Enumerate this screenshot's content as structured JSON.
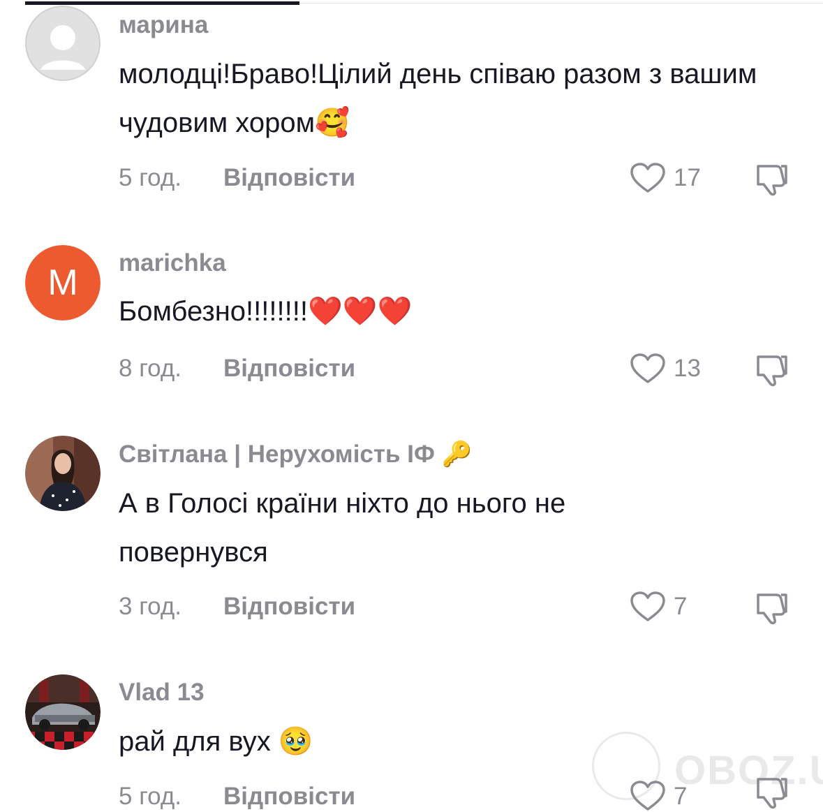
{
  "comments": [
    {
      "username": "марина",
      "text": "молодці!Браво!Цілий день співаю разом з вашим чудовим хором🥰",
      "time": "5 год.",
      "reply_label": "Відповісти",
      "likes": "17",
      "avatar": "default-avatar"
    },
    {
      "username": "marichka",
      "avatar_letter": "M",
      "text": "Бомбезно!!!!!!!!❤️❤️❤️",
      "time": "8 год.",
      "reply_label": "Відповісти",
      "likes": "13",
      "avatar_color": "#ee5a2f"
    },
    {
      "username": "Світлана | Нерухомість ІФ 🔑",
      "text": "А в Голосі країни ніхто до нього не повернувся",
      "time": "3 год.",
      "reply_label": "Відповісти",
      "likes": "7",
      "avatar": "photo-woman"
    },
    {
      "username": "Vlad 13",
      "text": "рай для вух 🥹",
      "time": "5 год.",
      "reply_label": "Відповісти",
      "likes": "7",
      "avatar": "photo-car"
    }
  ],
  "watermark": "OBOZ.UA",
  "colors": {
    "muted": "#8a8b91",
    "text": "#161823",
    "avatar_orange": "#ee5a2f"
  }
}
